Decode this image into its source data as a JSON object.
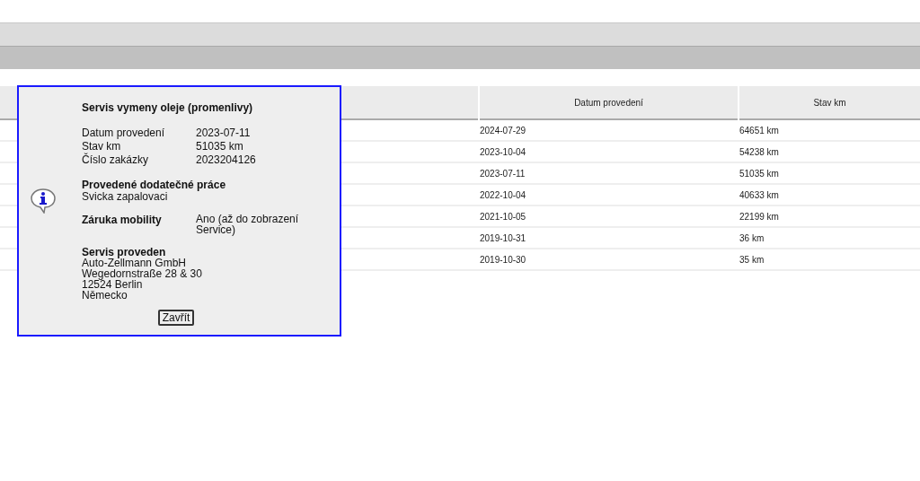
{
  "table": {
    "columns": [
      "Datum provedení",
      "Stav km"
    ],
    "rows": [
      {
        "date": "2024-07-29",
        "km": "64651 km"
      },
      {
        "date": "2023-10-04",
        "km": "54238 km"
      },
      {
        "date": "2023-07-11",
        "km": "51035 km"
      },
      {
        "date": "2022-10-04",
        "km": "40633 km"
      },
      {
        "date": "2021-10-05",
        "km": "22199 km"
      },
      {
        "date": "2019-10-31",
        "km": "36 km"
      },
      {
        "date": "2019-10-30",
        "km": "35 km"
      }
    ]
  },
  "popup": {
    "title": "Servis vymeny oleje (promenlivy)",
    "details": [
      {
        "label": "Datum provedení",
        "value": "2023-07-11"
      },
      {
        "label": "Stav km",
        "value": "51035 km"
      },
      {
        "label": "Číslo zakázky",
        "value": "2023204126"
      }
    ],
    "extra_work": {
      "heading": "Provedené dodatečné práce",
      "text": "Svicka zapalovaci"
    },
    "mobility": {
      "label": "Záruka mobility",
      "value": "Ano (až do zobrazení Service)"
    },
    "performed_by": {
      "heading": "Servis proveden",
      "lines": [
        "Auto-Zellmann GmbH",
        "Wegedornstraße 28 & 30",
        "12524 Berlin",
        "Německo"
      ]
    },
    "close_button": "Zavřít"
  }
}
